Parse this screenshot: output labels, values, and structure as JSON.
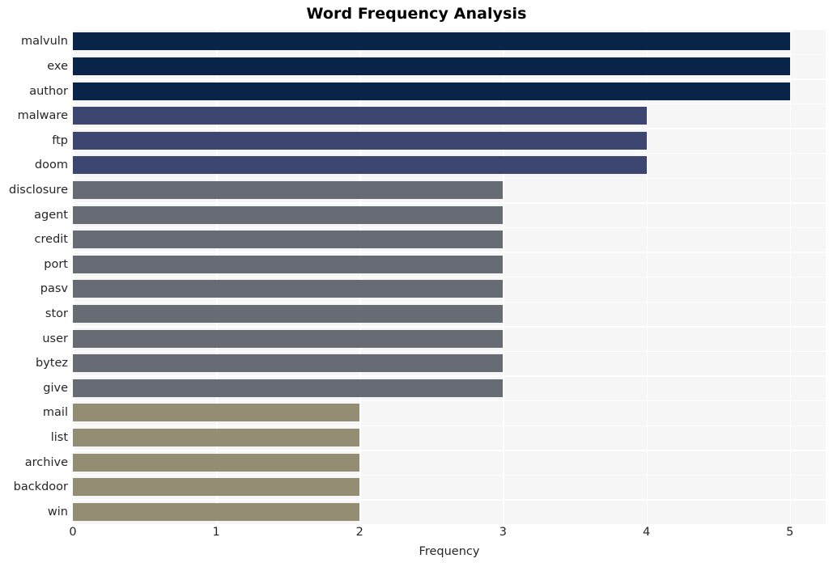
{
  "chart_data": {
    "type": "bar",
    "orientation": "horizontal",
    "title": "Word Frequency Analysis",
    "xlabel": "Frequency",
    "ylabel": "",
    "xlim": [
      0,
      5.25
    ],
    "xticks": [
      "0",
      "1",
      "2",
      "3",
      "4",
      "5"
    ],
    "xtick_values": [
      0,
      1,
      2,
      3,
      4,
      5
    ],
    "grid": true,
    "legend": null,
    "categories": [
      "malvuln",
      "exe",
      "author",
      "malware",
      "ftp",
      "doom",
      "disclosure",
      "agent",
      "credit",
      "port",
      "pasv",
      "stor",
      "user",
      "bytez",
      "give",
      "mail",
      "list",
      "archive",
      "backdoor",
      "win"
    ],
    "values": [
      5,
      5,
      5,
      4,
      4,
      4,
      3,
      3,
      3,
      3,
      3,
      3,
      3,
      3,
      3,
      2,
      2,
      2,
      2,
      2
    ],
    "bar_colors": [
      "#082448",
      "#082448",
      "#082448",
      "#3c4670",
      "#3c4670",
      "#3c4670",
      "#676b74",
      "#676b74",
      "#676b74",
      "#676b74",
      "#676b74",
      "#676b74",
      "#676b74",
      "#676b74",
      "#676b74",
      "#938d74",
      "#938d74",
      "#938d74",
      "#938d74",
      "#938d74"
    ]
  },
  "style": {
    "plot_background": "#f6f6f7",
    "grid_color": "#ffffff",
    "figure_background": "#ffffff",
    "text_color": "#262626",
    "title_color": "#000000"
  }
}
